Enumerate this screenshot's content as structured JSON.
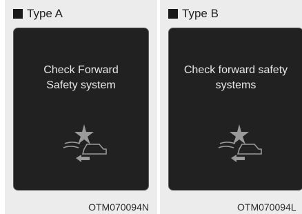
{
  "panels": [
    {
      "title": "Type A",
      "message": "Check Forward\nSafety system",
      "icon": "forward-collision-warning-icon",
      "code": "OTM070094N"
    },
    {
      "title": "Type B",
      "message": "Check forward safety\nsystems",
      "icon": "forward-collision-warning-icon",
      "code": "OTM070094L"
    }
  ],
  "colors": {
    "screen": "#212121",
    "panel_bg": "#ececec",
    "text_on_screen": "#e8e8e8"
  }
}
